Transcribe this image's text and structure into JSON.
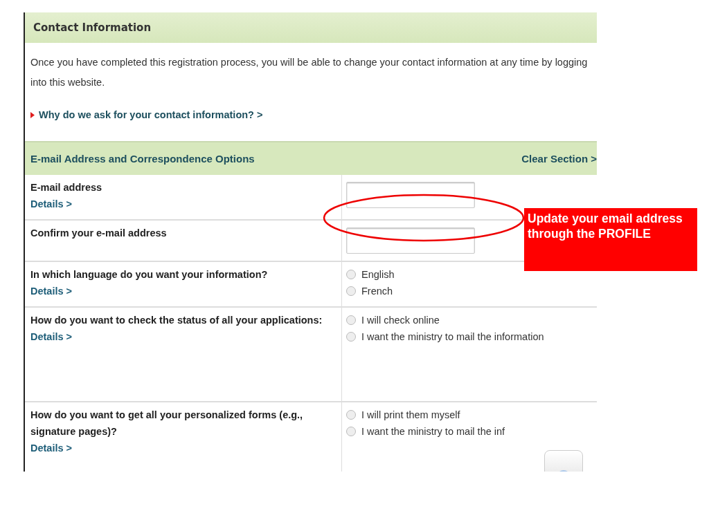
{
  "header": {
    "title": "Contact Information"
  },
  "intro": "Once you have completed this registration process, you will be able to change your contact information at any time by logging into this website.",
  "help_link": "Why do we ask for your contact information? >",
  "section": {
    "title": "E-mail Address and Correspondence Options",
    "action": "Clear Section >"
  },
  "rows": [
    {
      "kind": "field",
      "label": "E-mail address",
      "details": "Details >"
    },
    {
      "kind": "field",
      "label": "Confirm your e-mail address"
    },
    {
      "kind": "radio",
      "label": "In which language do you want your information?",
      "details": "Details >",
      "options": [
        {
          "label": "English",
          "selected": false
        },
        {
          "label": "French",
          "selected": false
        }
      ]
    },
    {
      "kind": "radio",
      "label": "How do you want to check the status of all your applications:",
      "details": "Details >",
      "options": [
        {
          "label": "I will check online",
          "selected": false
        },
        {
          "label": "I want the ministry to mail the information",
          "selected": false
        }
      ]
    },
    {
      "kind": "radio",
      "label": "How do you want to get all your personalized forms (e.g., signature pages)?",
      "details": "Details >",
      "options": [
        {
          "label": "I will print them myself",
          "selected": false
        },
        {
          "label": "I want the ministry to mail the inf",
          "selected": false
        }
      ]
    }
  ],
  "callout": {
    "text": "Update your email address through the PROFILE"
  }
}
